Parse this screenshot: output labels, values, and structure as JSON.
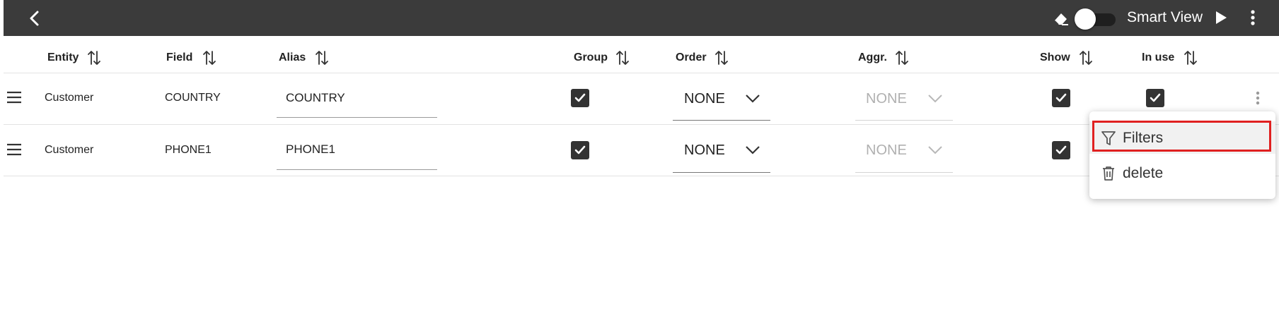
{
  "toolbar": {
    "smart_view_label": "Smart View",
    "smart_view_enabled": false
  },
  "columns": [
    {
      "key": "entity",
      "label": "Entity"
    },
    {
      "key": "field",
      "label": "Field"
    },
    {
      "key": "alias",
      "label": "Alias"
    },
    {
      "key": "group",
      "label": "Group"
    },
    {
      "key": "order",
      "label": "Order"
    },
    {
      "key": "aggr",
      "label": "Aggr."
    },
    {
      "key": "show",
      "label": "Show"
    },
    {
      "key": "in_use",
      "label": "In use"
    }
  ],
  "rows": [
    {
      "entity": "Customer",
      "field": "COUNTRY",
      "alias": "COUNTRY",
      "group": true,
      "order": "NONE",
      "aggr": "NONE",
      "aggr_disabled": true,
      "show": true,
      "in_use": true
    },
    {
      "entity": "Customer",
      "field": "PHONE1",
      "alias": "PHONE1",
      "group": true,
      "order": "NONE",
      "aggr": "NONE",
      "aggr_disabled": true,
      "show": true,
      "in_use": true
    }
  ],
  "context_menu": {
    "items": [
      {
        "label": "Filters",
        "icon": "filter-icon",
        "highlighted": true
      },
      {
        "label": "delete",
        "icon": "trash-icon"
      }
    ]
  },
  "colors": {
    "topbar": "#3b3b3b",
    "checkbox": "#333333",
    "highlight": "#e02020",
    "disabled_text": "#b0b0b0"
  }
}
